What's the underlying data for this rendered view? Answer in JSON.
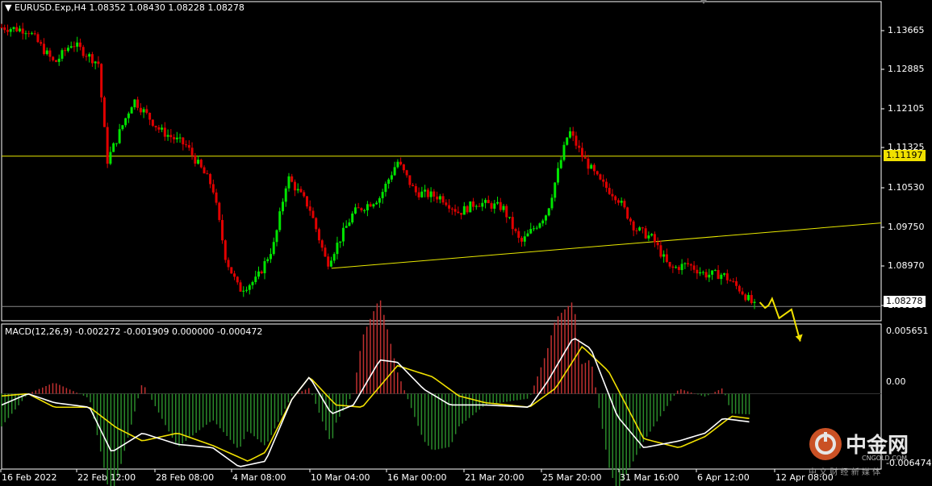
{
  "header": {
    "symbol": "EURUSD.Exp,H4",
    "open": "1.08352",
    "high": "1.08430",
    "low": "1.08228",
    "close": "1.08278"
  },
  "price_axis": {
    "labels": [
      "1.13665",
      "1.12885",
      "1.12105",
      "1.11325",
      "1.10530",
      "1.09750",
      "1.08970",
      "1.08190"
    ],
    "hline_label": "1.11197",
    "current_label": "1.08278"
  },
  "macd": {
    "label": "MACD(12,26,9) -0.002272 -0.001909 0.000000 -0.000472",
    "ticks": [
      "0.005651",
      "0.00",
      "-0.006474"
    ]
  },
  "time_axis": [
    "16 Feb 2022",
    "22 Feb 12:00",
    "28 Feb 08:00",
    "4 Mar 08:00",
    "10 Mar 04:00",
    "16 Mar 00:00",
    "21 Mar 20:00",
    "25 Mar 20:00",
    "31 Mar 16:00",
    "6 Apr 12:00",
    "12 Apr 08:00"
  ],
  "watermark": {
    "name": "中金网",
    "sub": "CNGOLD.COM",
    "tagline": "中 文 财 经 新 媒 体"
  },
  "colors": {
    "bull": "#00e400",
    "bear": "#e00000",
    "hline": "#e8e800",
    "macd_line": "#ffffff",
    "signal_line": "#f0e000",
    "current_tag": "#ffffff",
    "hline_tag": "#f0e000"
  },
  "chart_data": {
    "type": "candlestick",
    "ylim": [
      1.08,
      1.142
    ],
    "horizontal_level": 1.11197,
    "current_price": 1.08278,
    "trendline": [
      [
        0.375,
        1.0902
      ],
      [
        1.0,
        1.099
      ]
    ],
    "forecast_path": [
      [
        0.862,
        1.0836
      ],
      [
        0.868,
        1.0825
      ],
      [
        0.872,
        1.083
      ],
      [
        0.876,
        1.0843
      ],
      [
        0.884,
        1.0805
      ],
      [
        0.898,
        1.0822
      ],
      [
        0.908,
        1.076
      ]
    ],
    "close_anchors": [
      [
        0,
        1.137
      ],
      [
        0.03,
        1.1365
      ],
      [
        0.06,
        1.13
      ],
      [
        0.08,
        1.134
      ],
      [
        0.11,
        1.13
      ],
      [
        0.12,
        1.111
      ],
      [
        0.15,
        1.123
      ],
      [
        0.18,
        1.117
      ],
      [
        0.21,
        1.114
      ],
      [
        0.24,
        1.106
      ],
      [
        0.255,
        1.092
      ],
      [
        0.27,
        1.086
      ],
      [
        0.29,
        1.088
      ],
      [
        0.31,
        1.095
      ],
      [
        0.325,
        1.108
      ],
      [
        0.35,
        1.102
      ],
      [
        0.37,
        1.091
      ],
      [
        0.4,
        1.101
      ],
      [
        0.43,
        1.104
      ],
      [
        0.45,
        1.111
      ],
      [
        0.47,
        1.105
      ],
      [
        0.5,
        1.104
      ],
      [
        0.52,
        1.101
      ],
      [
        0.54,
        1.103
      ],
      [
        0.57,
        1.102
      ],
      [
        0.59,
        1.095
      ],
      [
        0.62,
        1.101
      ],
      [
        0.645,
        1.117
      ],
      [
        0.66,
        1.112
      ],
      [
        0.68,
        1.107
      ],
      [
        0.7,
        1.104
      ],
      [
        0.72,
        1.098
      ],
      [
        0.74,
        1.096
      ],
      [
        0.76,
        1.09
      ],
      [
        0.78,
        1.091
      ],
      [
        0.8,
        1.089
      ],
      [
        0.82,
        1.089
      ],
      [
        0.84,
        1.086
      ],
      [
        0.856,
        1.0828
      ]
    ],
    "macd_ylim": [
      -0.0067,
      0.0062
    ],
    "macd_anchors": [
      [
        0,
        -0.001
      ],
      [
        0.03,
        0.0
      ],
      [
        0.06,
        -0.0008
      ],
      [
        0.1,
        -0.0012
      ],
      [
        0.125,
        -0.0052
      ],
      [
        0.16,
        -0.0035
      ],
      [
        0.2,
        -0.0045
      ],
      [
        0.24,
        -0.0048
      ],
      [
        0.27,
        -0.0065
      ],
      [
        0.3,
        -0.006
      ],
      [
        0.33,
        -0.0005
      ],
      [
        0.35,
        0.0015
      ],
      [
        0.375,
        -0.0018
      ],
      [
        0.4,
        -0.001
      ],
      [
        0.43,
        0.003
      ],
      [
        0.45,
        0.0028
      ],
      [
        0.48,
        0.0004
      ],
      [
        0.51,
        -0.001
      ],
      [
        0.55,
        -0.001
      ],
      [
        0.6,
        -0.0012
      ],
      [
        0.62,
        0.001
      ],
      [
        0.65,
        0.005
      ],
      [
        0.67,
        0.004
      ],
      [
        0.7,
        -0.002
      ],
      [
        0.73,
        -0.0048
      ],
      [
        0.77,
        -0.0042
      ],
      [
        0.8,
        -0.0035
      ],
      [
        0.82,
        -0.0022
      ],
      [
        0.85,
        -0.0025
      ]
    ],
    "signal_anchors": [
      [
        0,
        -0.0002
      ],
      [
        0.03,
        0.0
      ],
      [
        0.06,
        -0.0012
      ],
      [
        0.1,
        -0.0012
      ],
      [
        0.13,
        -0.003
      ],
      [
        0.16,
        -0.0042
      ],
      [
        0.2,
        -0.0035
      ],
      [
        0.24,
        -0.0046
      ],
      [
        0.28,
        -0.006
      ],
      [
        0.3,
        -0.0052
      ],
      [
        0.33,
        -0.0005
      ],
      [
        0.35,
        0.0015
      ],
      [
        0.38,
        -0.001
      ],
      [
        0.41,
        -0.0012
      ],
      [
        0.45,
        0.0025
      ],
      [
        0.49,
        0.0015
      ],
      [
        0.52,
        -0.0002
      ],
      [
        0.55,
        -0.0008
      ],
      [
        0.6,
        -0.0012
      ],
      [
        0.63,
        0.0005
      ],
      [
        0.66,
        0.0042
      ],
      [
        0.69,
        0.002
      ],
      [
        0.73,
        -0.004
      ],
      [
        0.77,
        -0.0048
      ],
      [
        0.8,
        -0.0038
      ],
      [
        0.83,
        -0.002
      ],
      [
        0.85,
        -0.0022
      ]
    ]
  }
}
